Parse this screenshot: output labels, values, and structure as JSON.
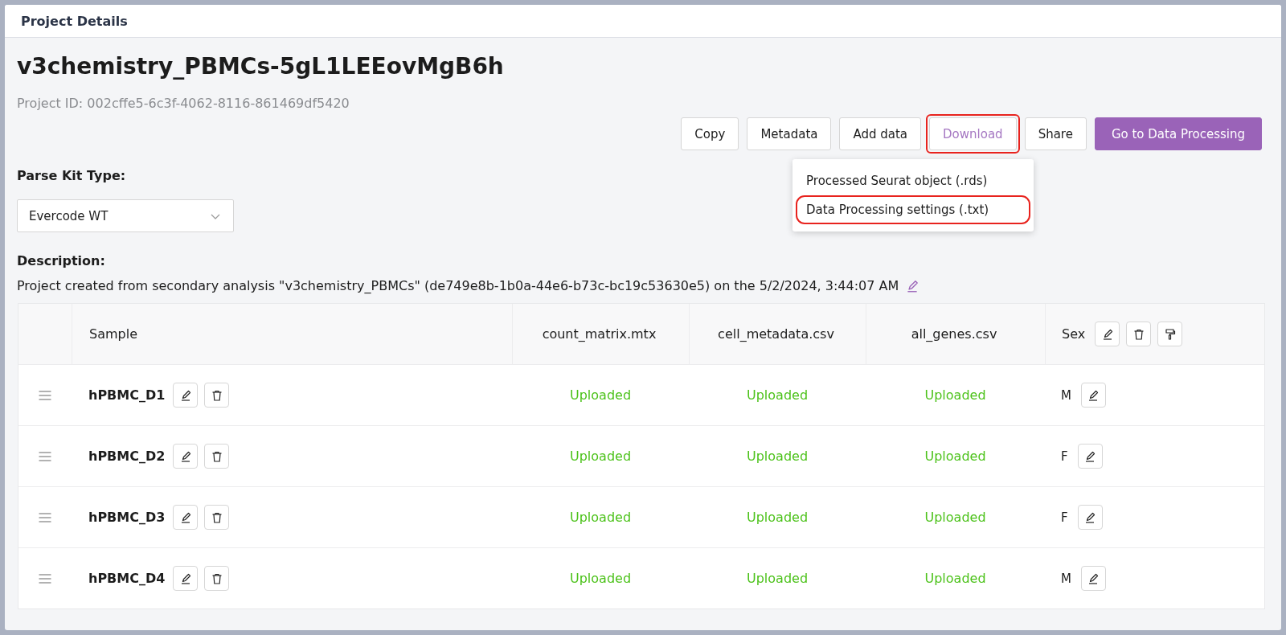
{
  "header": {
    "title": "Project Details"
  },
  "project": {
    "name": "v3chemistry_PBMCs-5gL1LEEovMgB6h",
    "id_text": "Project ID: 002cffe5-6c3f-4062-8116-861469df5420"
  },
  "actions": [
    {
      "label": "Copy",
      "kind": "default",
      "open": false,
      "highlighted": false
    },
    {
      "label": "Metadata",
      "kind": "default",
      "open": false,
      "highlighted": false
    },
    {
      "label": "Add data",
      "kind": "default",
      "open": false,
      "highlighted": false
    },
    {
      "label": "Download",
      "kind": "default",
      "open": true,
      "highlighted": true
    },
    {
      "label": "Share",
      "kind": "default",
      "open": false,
      "highlighted": false
    },
    {
      "label": "Go to Data Processing",
      "kind": "primary",
      "open": false,
      "highlighted": false
    }
  ],
  "download_menu": [
    {
      "label": "Processed Seurat object (.rds)",
      "highlighted": false
    },
    {
      "label": "Data Processing settings (.txt)",
      "highlighted": true
    }
  ],
  "kit": {
    "label": "Parse Kit Type:",
    "value": "Evercode WT"
  },
  "description": {
    "label": "Description:",
    "text": "Project created from secondary analysis \"v3chemistry_PBMCs\" (de749e8b-1b0a-44e6-b73c-bc19c53630e5) on the 5/2/2024, 3:44:07 AM"
  },
  "table": {
    "columns": [
      {
        "label": "Sample",
        "kind": "sample"
      },
      {
        "label": "count_matrix.mtx",
        "kind": "file"
      },
      {
        "label": "cell_metadata.csv",
        "kind": "file"
      },
      {
        "label": "all_genes.csv",
        "kind": "file"
      },
      {
        "label": "Sex",
        "kind": "metadata"
      }
    ],
    "rows": [
      {
        "cells": [
          "hPBMC_D1",
          "Uploaded",
          "Uploaded",
          "Uploaded",
          "M"
        ]
      },
      {
        "cells": [
          "hPBMC_D2",
          "Uploaded",
          "Uploaded",
          "Uploaded",
          "F"
        ]
      },
      {
        "cells": [
          "hPBMC_D3",
          "Uploaded",
          "Uploaded",
          "Uploaded",
          "F"
        ]
      },
      {
        "cells": [
          "hPBMC_D4",
          "Uploaded",
          "Uploaded",
          "Uploaded",
          "M"
        ]
      }
    ]
  }
}
